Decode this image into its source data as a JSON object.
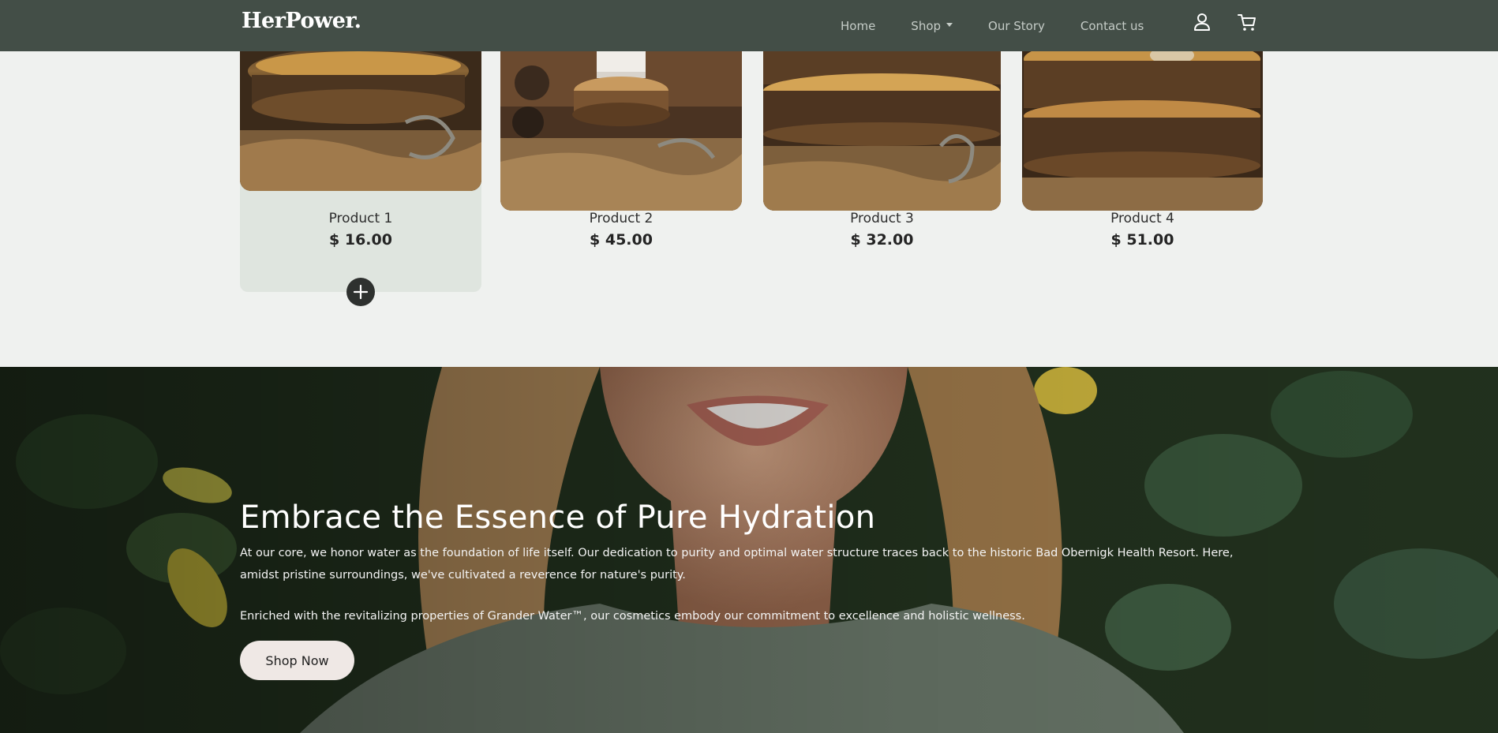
{
  "header": {
    "logo": "HerPower.",
    "nav": [
      {
        "label": "Home"
      },
      {
        "label": "Shop"
      },
      {
        "label": "Our Story"
      },
      {
        "label": "Contact us"
      }
    ],
    "icons": [
      "user-icon",
      "cart-icon"
    ]
  },
  "products": [
    {
      "name": "Product 1",
      "price": "$ 16.00"
    },
    {
      "name": "Product 2",
      "price": "$ 45.00"
    },
    {
      "name": "Product 3",
      "price": "$ 32.00"
    },
    {
      "name": "Product 4",
      "price": "$ 51.00"
    }
  ],
  "hero": {
    "title": "Embrace the Essence of Pure Hydration",
    "paragraph1": "At our core, we honor water as the foundation of life itself. Our dedication to purity and optimal water structure traces back to the historic Bad Obernigk Health Resort. Here, amidst pristine surroundings, we've cultivated a reverence for nature's purity.",
    "paragraph2": "Enriched with the revitalizing properties of Grander Water™, our cosmetics embody our commitment to excellence and holistic wellness.",
    "cta": "Shop Now"
  },
  "colors": {
    "header_bg": "#434e47",
    "page_bg": "#eff1ef",
    "active_card_bg": "#dfe5df",
    "add_button": "#2e312f",
    "cta_bg": "#efe8e5"
  }
}
